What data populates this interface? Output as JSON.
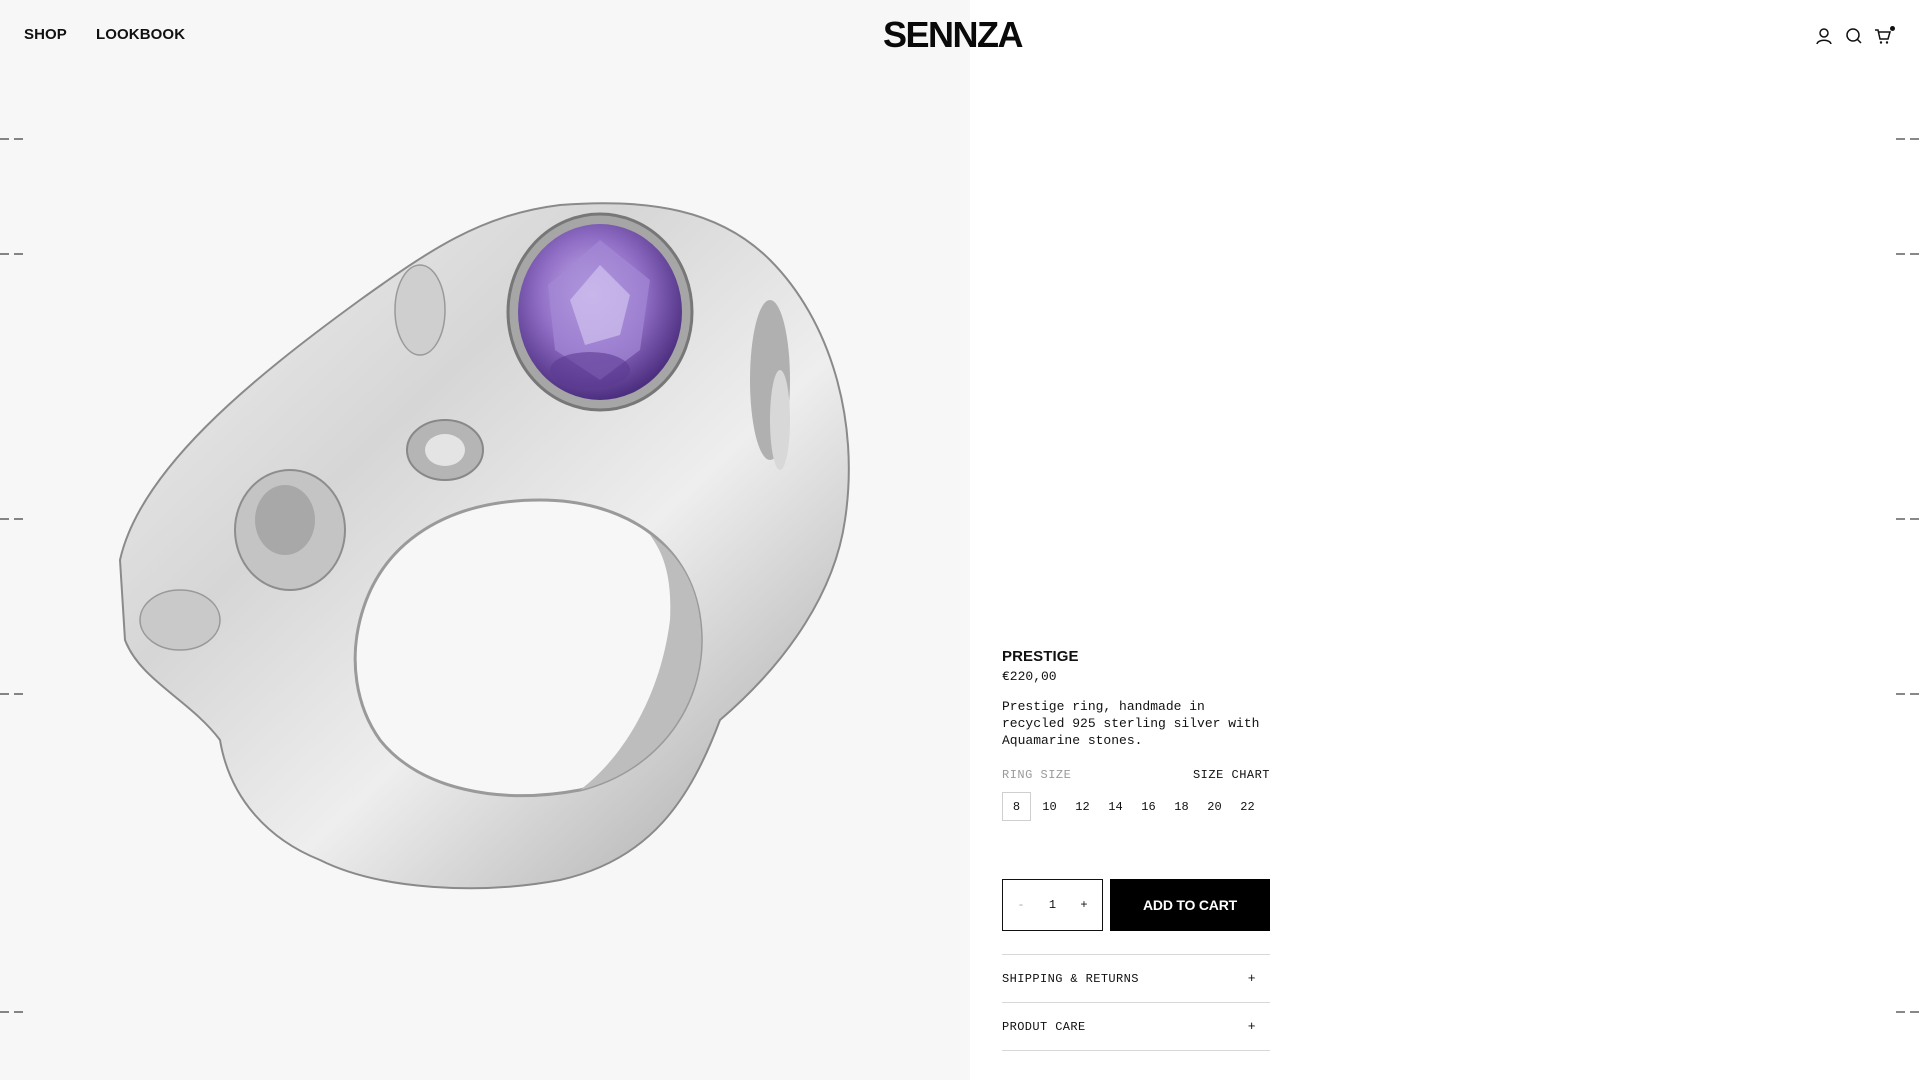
{
  "brand": {
    "logo": "SENNZA"
  },
  "nav": {
    "shop": "SHOP",
    "lookbook": "LOOKBOOK"
  },
  "header_icons": [
    "account-icon",
    "search-icon",
    "cart-icon"
  ],
  "product": {
    "image_alt": "Silver ring with purple gemstone",
    "title": "PRESTIGE",
    "price": "€220,00",
    "description": "Prestige ring, handmade in recycled 925 sterling silver with Aquamarine stones.",
    "ring_size_label": "RING SIZE",
    "size_chart_label": "SIZE CHART",
    "sizes": [
      "8",
      "10",
      "12",
      "14",
      "16",
      "18",
      "20",
      "22"
    ],
    "selected_size": "8",
    "quantity": "1",
    "qty_minus": "-",
    "qty_plus": "+",
    "add_to_cart": "ADD TO CART",
    "accordion": [
      {
        "label": "SHIPPING & RETURNS",
        "icon": "+"
      },
      {
        "label": "PRODUT CARE",
        "icon": "+"
      }
    ]
  },
  "colors": {
    "accent": "#000000",
    "image_bg": "#f7f7f7",
    "gem": "#8e6cc4"
  }
}
